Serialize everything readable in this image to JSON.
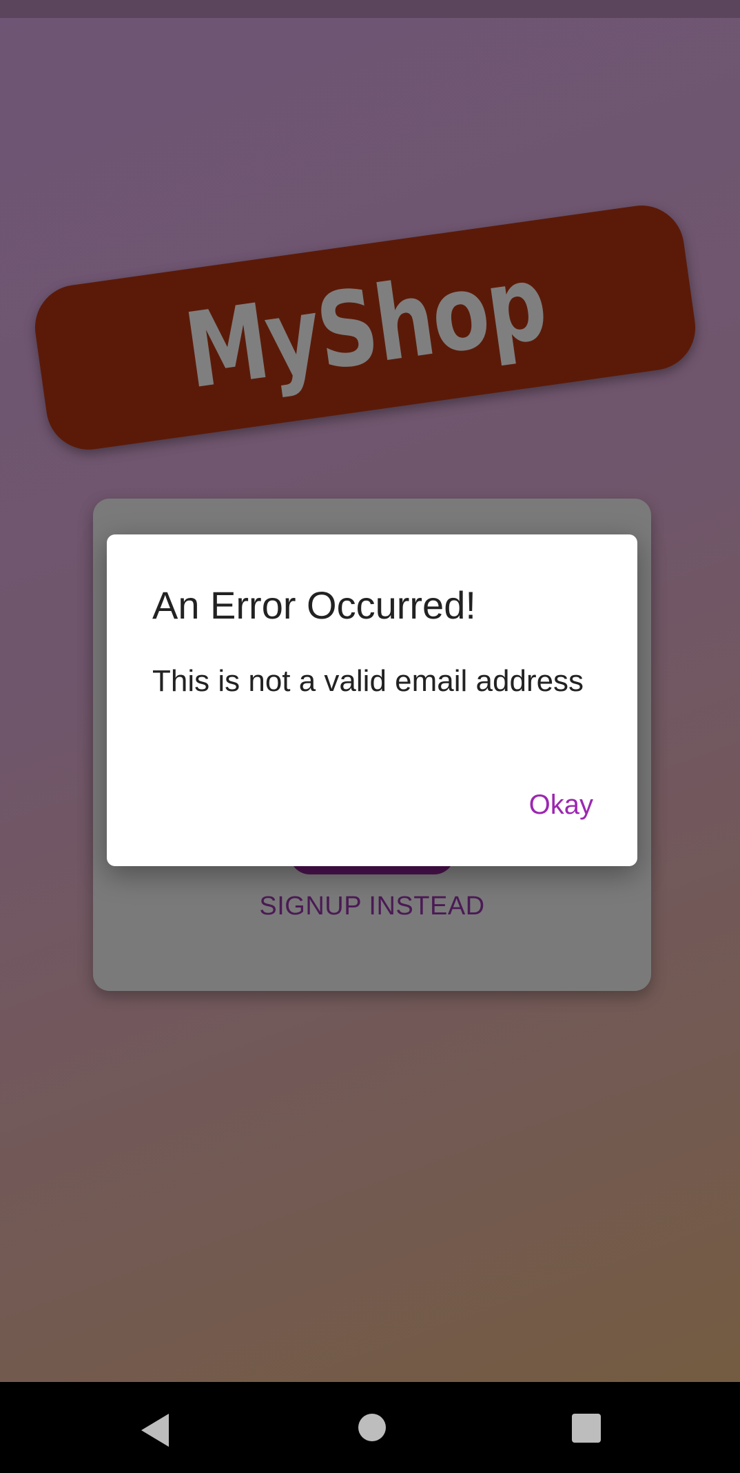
{
  "app": {
    "logo_text": "MyShop"
  },
  "auth_card": {
    "switch_label": "SIGNUP INSTEAD"
  },
  "dialog": {
    "title": "An Error Occurred!",
    "message": "This is not a valid email address",
    "confirm_label": "Okay"
  },
  "colors": {
    "banner": "#5b1a08",
    "accent": "#9c27b0",
    "primary_dark": "#4c1250",
    "card": "#7a7a7a"
  },
  "navbar": {
    "icons": [
      "back-icon",
      "home-icon",
      "recents-icon"
    ]
  }
}
